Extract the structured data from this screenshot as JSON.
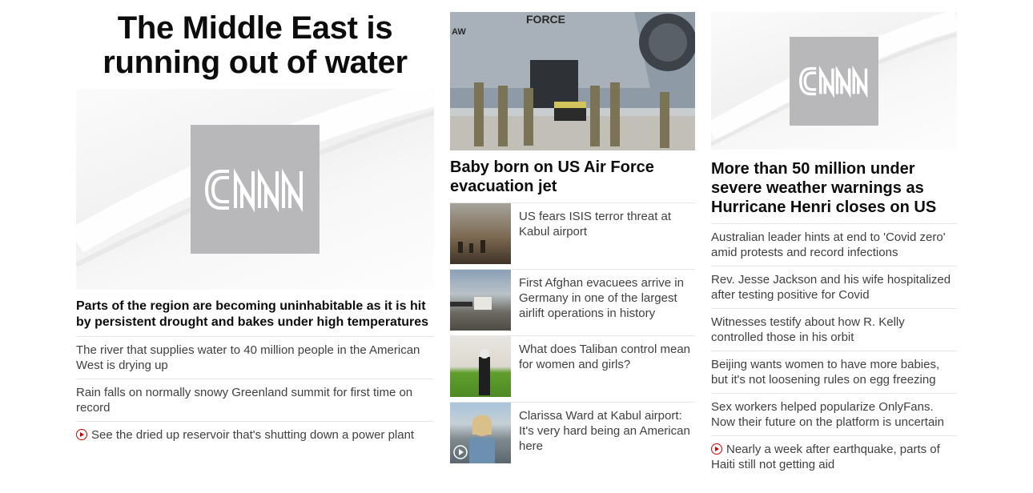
{
  "left": {
    "headline": "The Middle East is running out of water",
    "image_logo": "CNN",
    "lead": "Parts of the region are becoming uninhabitable as it is hit by persistent drought and bakes under high temperatures",
    "items": [
      {
        "text": "The river that supplies water to 40 million people in the American West is drying up"
      },
      {
        "text": "Rain falls on normally snowy Greenland summit for first time on record"
      },
      {
        "text": "See the dried up reservoir that's shutting down a power plant",
        "video": true
      }
    ]
  },
  "middle": {
    "hero_headline": "Baby born on US Air Force evacuation jet",
    "items": [
      {
        "text": "US fears ISIS terror threat at Kabul airport"
      },
      {
        "text": "First Afghan evacuees arrive in Germany in one of the largest airlift operations in history"
      },
      {
        "text": "What does Taliban control mean for women and girls?"
      },
      {
        "text": "Clarissa Ward at Kabul airport: It's very hard being an American here",
        "video": true
      }
    ]
  },
  "right": {
    "image_logo": "CNN",
    "headline": "More than 50 million under severe weather warnings as Hurricane Henri closes on US",
    "items": [
      {
        "text": "Australian leader hints at end to 'Covid zero' amid protests and record infections"
      },
      {
        "text": "Rev. Jesse Jackson and his wife hospitalized after testing positive for Covid"
      },
      {
        "text": "Witnesses testify about how R. Kelly controlled those in his orbit"
      },
      {
        "text": "Beijing wants women to have more babies, but it's not loosening rules on egg freezing"
      },
      {
        "text": "Sex workers helped popularize OnlyFans. Now their future on the platform is uncertain"
      },
      {
        "text": "Nearly a week after earthquake, parts of Haiti still not getting aid",
        "video": true
      }
    ]
  },
  "colors": {
    "video_icon": "#cc0000",
    "logo_box": "#b8b8bb",
    "divider": "#e6e6e6"
  }
}
